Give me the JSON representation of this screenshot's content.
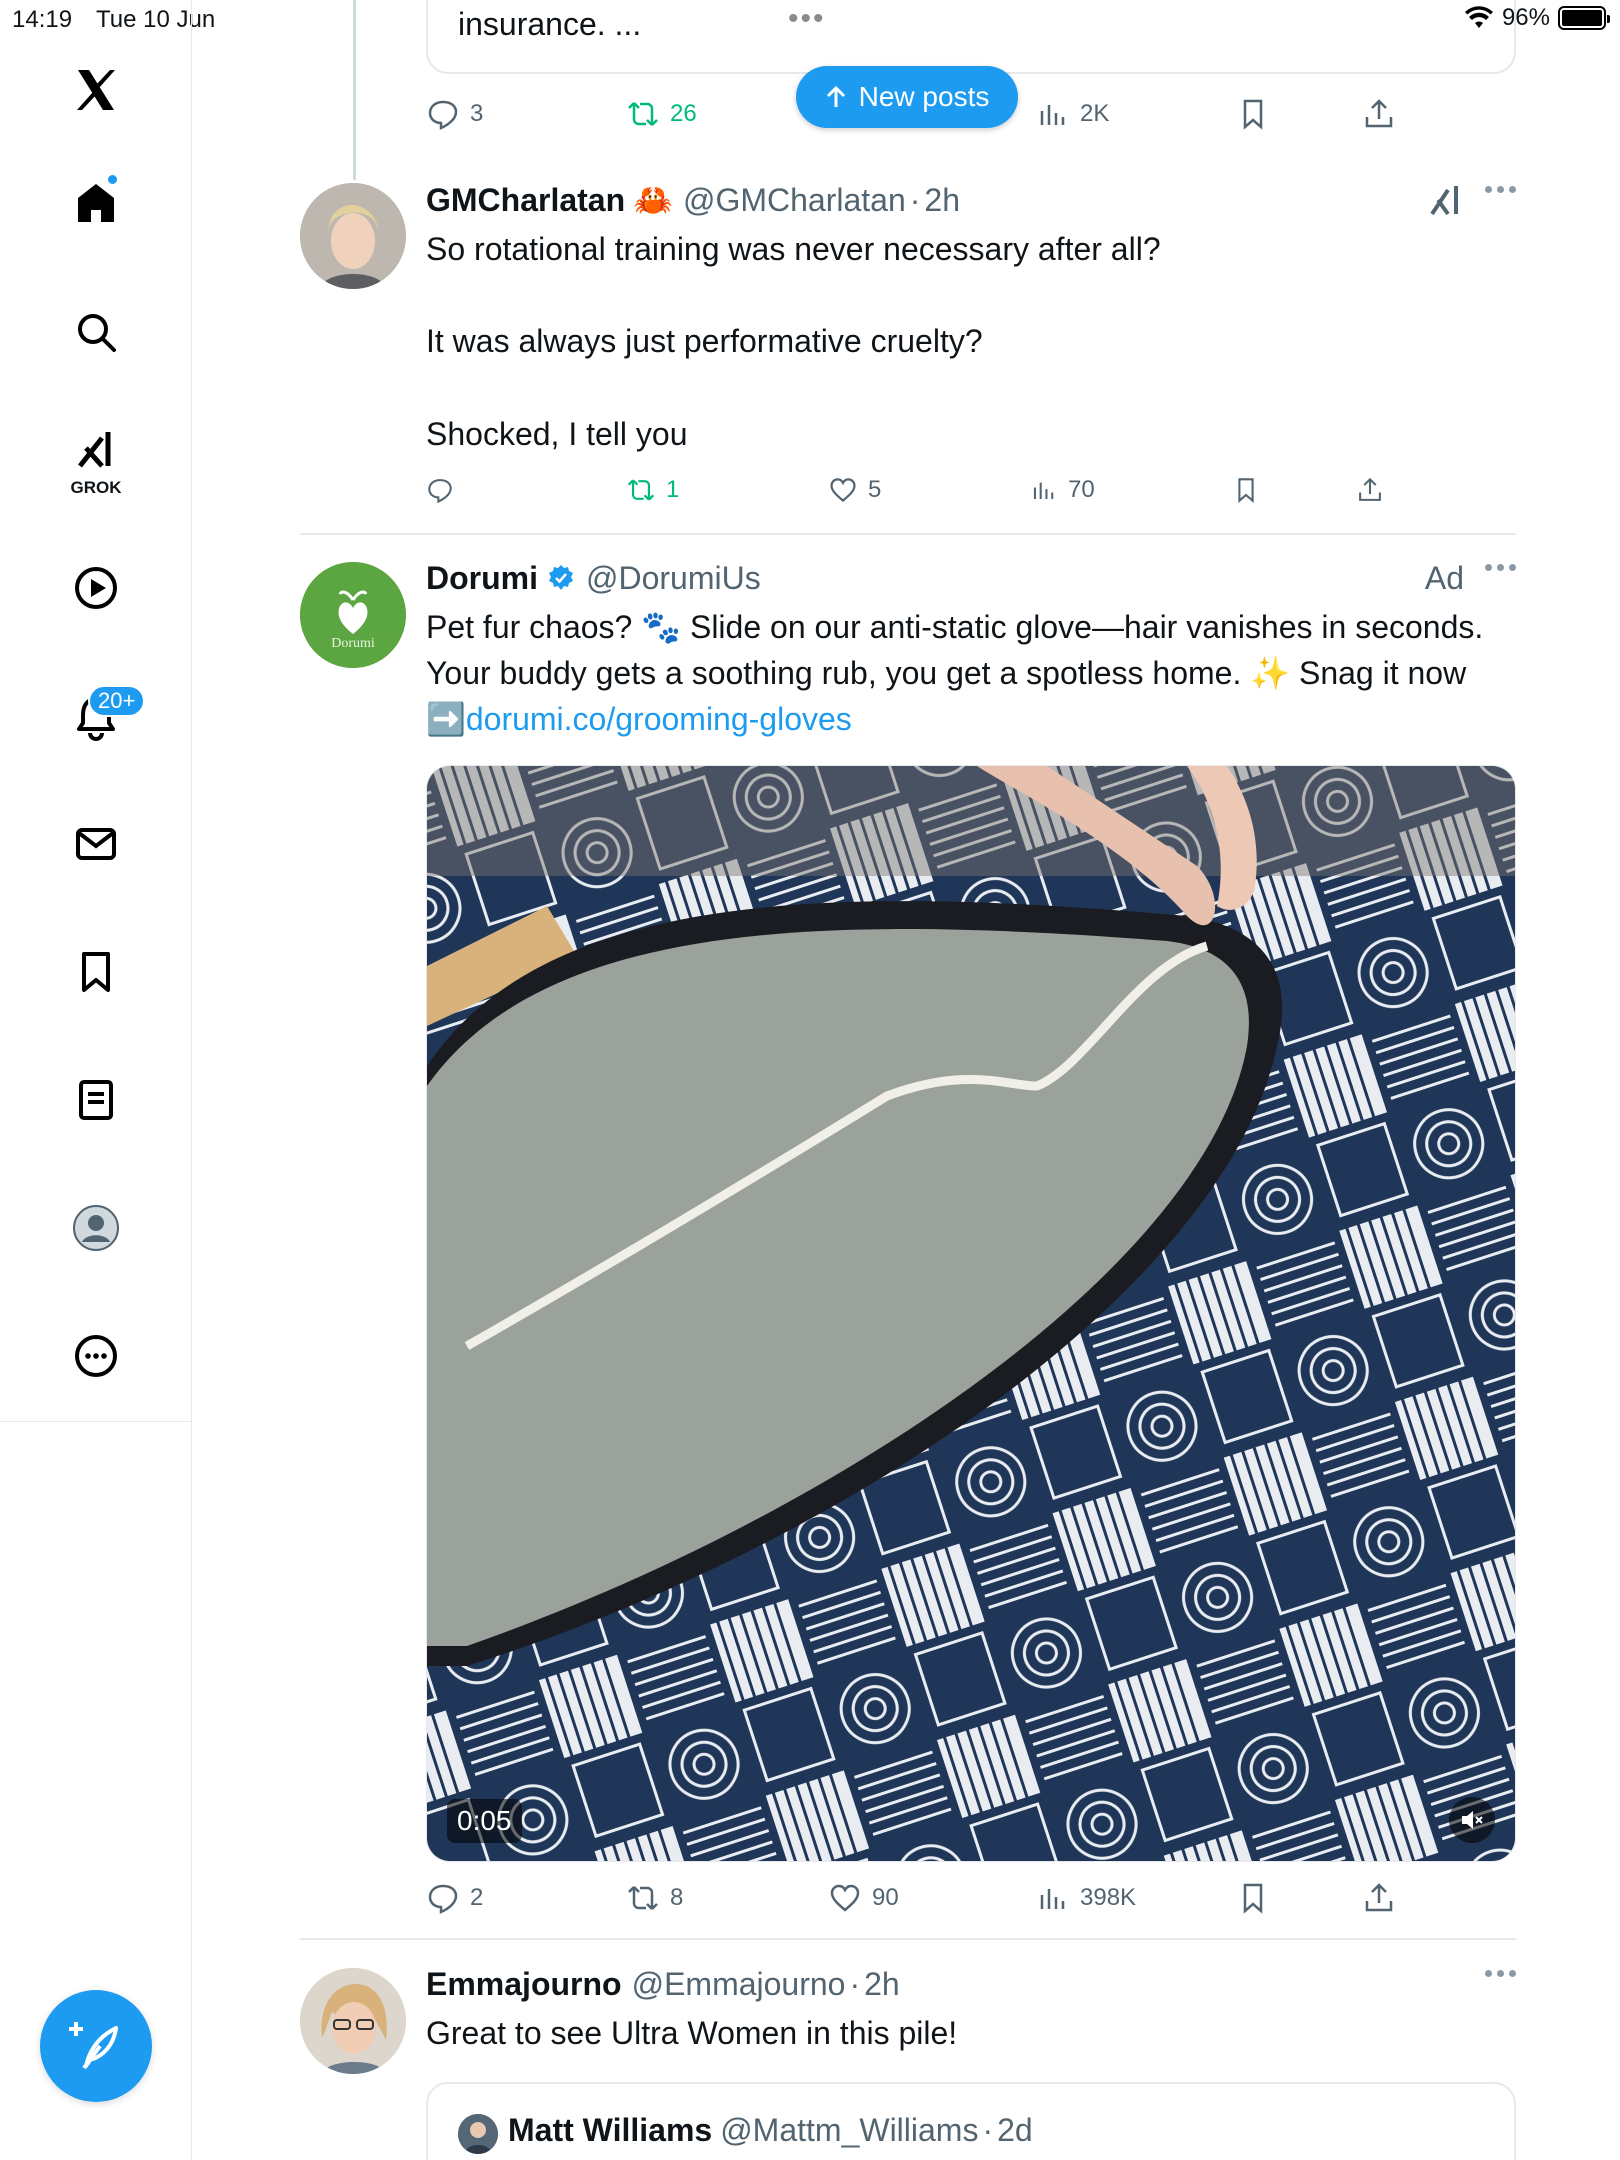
{
  "status_bar": {
    "time": "14:19",
    "date": "Tue 10 Jun",
    "battery": "96%"
  },
  "sidebar": {
    "grok_label": "GROK",
    "notifications_badge": "20+",
    "items": [
      "home-icon",
      "search-icon",
      "grok-icon",
      "video-icon",
      "notifications-icon",
      "messages-icon",
      "bookmarks-icon",
      "lists-icon",
      "profile-icon",
      "more-icon"
    ]
  },
  "new_posts": {
    "label": "New posts"
  },
  "prev_post": {
    "truncated_text": "insurance. ...",
    "replies": "3",
    "reposts": "26",
    "views": "2K"
  },
  "posts": [
    {
      "name": "GMCharlatan",
      "emoji": "🦀",
      "handle": "@GMCharlatan",
      "time": "2h",
      "lines": [
        "So rotational training was never necessary after all?",
        "It was always just performative cruelty?",
        "Shocked, I tell you"
      ],
      "replies": "",
      "reposts": "1",
      "likes": "5",
      "views": "70"
    },
    {
      "name": "Dorumi",
      "handle": "@DorumiUs",
      "ad_label": "Ad",
      "avatar_text": "Dorumi",
      "text_1": "Pet fur chaos? 🐾 Slide on our anti-static glove—hair vanishes in seconds. Your buddy gets a soothing rub, you get a spotless home. ✨ Snag it now ➡️",
      "link": "dorumi.co/grooming-gloves",
      "video_duration": "0:05",
      "replies": "2",
      "reposts": "8",
      "likes": "90",
      "views": "398K"
    },
    {
      "name": "Emmajourno",
      "handle": "@Emmajourno",
      "time": "2h",
      "text": "Great to see Ultra Women in this pile!",
      "quote": {
        "name": "Matt Williams",
        "handle": "@Mattm_Williams",
        "time": "2d"
      }
    }
  ],
  "colors": {
    "accent": "#1d9bf0",
    "repost_green": "#00ba7c",
    "muted": "#536471",
    "border": "#e6e8ea"
  }
}
